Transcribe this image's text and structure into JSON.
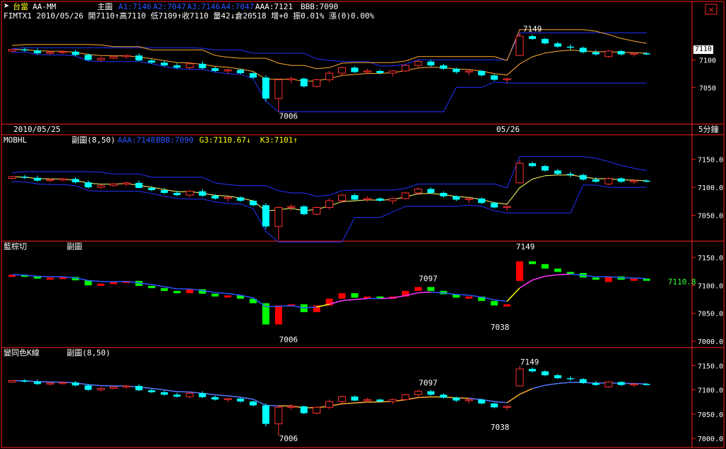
{
  "header": {
    "app_title": "台當",
    "template": "AA-MM",
    "main_label": "主圖",
    "a1": "A1:7146",
    "a2": "A2:7047",
    "a3": "A3:7146",
    "a4": "A4:7047",
    "aaa": "AAA:7121",
    "bbb": "BBB:7090",
    "symbol_line": "FIMTX1 2010/05/26 開7110↑高7110 低7109↑收7110 量42↓倉20518 增+0 振0.01% 漲(0)0.00%"
  },
  "panel2_header": {
    "name": "MOBHL",
    "sub": "副圖(8,50)",
    "aaa": "AAA:7148",
    "bbb": "BBB:7090",
    "g3": "G3:7110.67↓",
    "k3": "K3:7101↑"
  },
  "panel3_header": {
    "name": "藍棕切",
    "sub": "副圖"
  },
  "panel4_header": {
    "name": "變同色K線",
    "sub": "副圖(8,50)"
  },
  "dates": {
    "left": "2010/05/25",
    "right": "05/26",
    "period": "5分鐘"
  },
  "price_tag": "7110",
  "side_value": "7110.8",
  "colors": {
    "up": "#ff3030",
    "down": "#00ffff",
    "green": "#00ff00",
    "red": "#ff0000",
    "blue": "#2233ff",
    "orange": "#ffaa33",
    "yellow": "#ffff66",
    "magenta": "#ff33ff",
    "bg": "#000000",
    "border": "#ff2020"
  },
  "chart_data": [
    {
      "type": "candlestick",
      "title": "主圖",
      "y_ticks": [
        7100,
        7050
      ],
      "annotations": [
        "7149",
        "7006"
      ],
      "ylim": [
        6990,
        7170
      ]
    },
    {
      "type": "candlestick",
      "title": "MOBHL",
      "y_ticks": [
        "7150.0",
        "7100.0",
        "7050.0"
      ],
      "ylim": [
        7010,
        7175
      ]
    },
    {
      "type": "bar",
      "title": "藍棕切",
      "y_ticks": [
        "7150.0",
        "7100.0",
        "7050.0",
        "7000.0"
      ],
      "annotations": [
        "7149",
        "7097",
        "7038",
        "7006"
      ],
      "ylim": [
        6995,
        7160
      ]
    },
    {
      "type": "candlestick",
      "title": "變同色K線",
      "y_ticks": [
        "7150.0",
        "7100.0",
        "7050.0",
        "7000.0"
      ],
      "annotations": [
        "7149",
        "7097",
        "7038",
        "7006"
      ],
      "ylim": [
        6990,
        7165
      ]
    }
  ],
  "candles": [
    [
      7116,
      7120,
      7114,
      7119
    ],
    [
      7119,
      7122,
      7115,
      7117
    ],
    [
      7117,
      7121,
      7110,
      7112
    ],
    [
      7112,
      7116,
      7109,
      7114
    ],
    [
      7114,
      7117,
      7111,
      7115
    ],
    [
      7115,
      7118,
      7107,
      7109
    ],
    [
      7109,
      7112,
      7098,
      7100
    ],
    [
      7100,
      7106,
      7097,
      7103
    ],
    [
      7103,
      7108,
      7101,
      7106
    ],
    [
      7106,
      7110,
      7102,
      7108
    ],
    [
      7108,
      7112,
      7098,
      7099
    ],
    [
      7099,
      7102,
      7093,
      7095
    ],
    [
      7095,
      7099,
      7088,
      7090
    ],
    [
      7090,
      7094,
      7084,
      7086
    ],
    [
      7086,
      7095,
      7083,
      7093
    ],
    [
      7093,
      7097,
      7083,
      7085
    ],
    [
      7085,
      7088,
      7078,
      7080
    ],
    [
      7080,
      7084,
      7075,
      7082
    ],
    [
      7082,
      7084,
      7074,
      7076
    ],
    [
      7076,
      7078,
      7066,
      7068
    ],
    [
      7068,
      7072,
      7025,
      7030
    ],
    [
      7030,
      7066,
      7006,
      7064
    ],
    [
      7064,
      7070,
      7058,
      7066
    ],
    [
      7066,
      7068,
      7050,
      7052
    ],
    [
      7052,
      7066,
      7050,
      7064
    ],
    [
      7064,
      7080,
      7060,
      7076
    ],
    [
      7076,
      7088,
      7072,
      7086
    ],
    [
      7086,
      7089,
      7076,
      7078
    ],
    [
      7078,
      7084,
      7074,
      7080
    ],
    [
      7080,
      7082,
      7074,
      7076
    ],
    [
      7076,
      7082,
      7070,
      7080
    ],
    [
      7080,
      7092,
      7078,
      7090
    ],
    [
      7090,
      7100,
      7086,
      7097
    ],
    [
      7097,
      7100,
      7088,
      7090
    ],
    [
      7090,
      7093,
      7082,
      7084
    ],
    [
      7084,
      7086,
      7075,
      7078
    ],
    [
      7078,
      7082,
      7072,
      7080
    ],
    [
      7080,
      7082,
      7070,
      7072
    ],
    [
      7072,
      7074,
      7062,
      7064
    ],
    [
      7064,
      7068,
      7058,
      7066
    ],
    [
      7108,
      7149,
      7108,
      7143
    ],
    [
      7143,
      7146,
      7136,
      7138
    ],
    [
      7138,
      7140,
      7128,
      7130
    ],
    [
      7130,
      7133,
      7122,
      7124
    ],
    [
      7124,
      7128,
      7118,
      7122
    ],
    [
      7122,
      7124,
      7112,
      7114
    ],
    [
      7114,
      7118,
      7108,
      7110
    ],
    [
      7106,
      7118,
      7104,
      7116
    ],
    [
      7116,
      7118,
      7108,
      7110
    ],
    [
      7110,
      7114,
      7106,
      7112
    ],
    [
      7112,
      7114,
      7109,
      7110
    ]
  ]
}
